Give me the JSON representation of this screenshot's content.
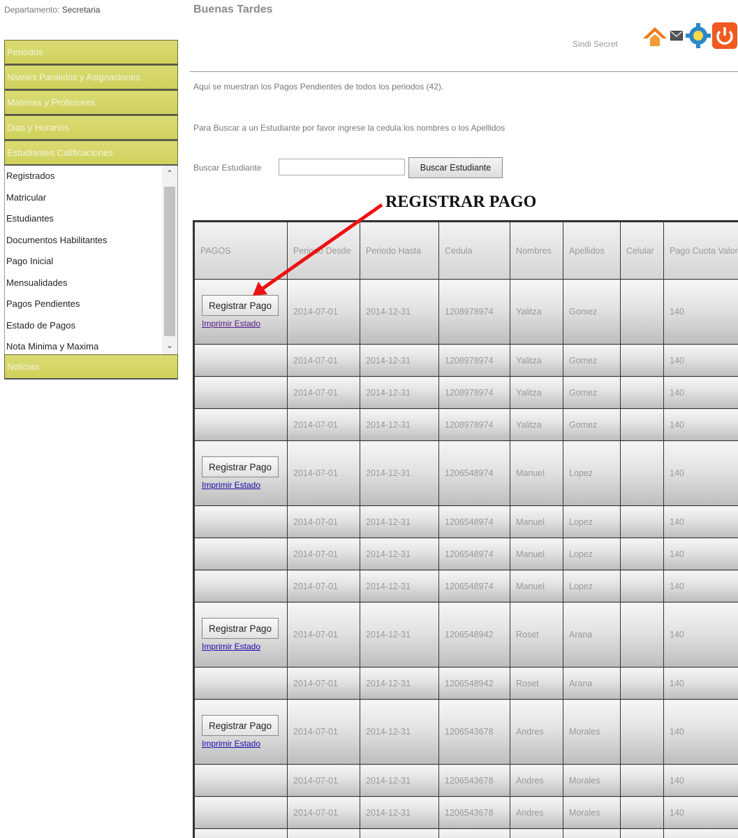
{
  "sidebar": {
    "department_label": "Departamento:",
    "department_value": "Secretaria",
    "menu": [
      "Periodos",
      "Niveles Paralelos y Asignaciones",
      "Materias y Profesores",
      "Dias y Horarios",
      "Estudiantes Calificaciones"
    ],
    "submenu": [
      "Registrados",
      "Matricular",
      "Estudiantes",
      "Documentos Habilitantes",
      "Pago Inicial",
      "Mensualidades",
      "Pagos Pendientes",
      "Estado de Pagos",
      "Nota Minima y Maxima"
    ],
    "last_menu": "Noticias",
    "accent_color": "#d5d766"
  },
  "header": {
    "greeting": "Buenas Tardes",
    "user": "Sindi Secret",
    "icons": [
      "home-icon",
      "mail-icon",
      "settings-icon",
      "power-icon"
    ]
  },
  "content": {
    "info_text": "Aqui se muestran los Pagos Pendientes de todos los periodos (42).",
    "search_help": "Para Buscar a un Estudiante por favor ingrese la cedula los nombres o los Apellidos",
    "search_label": "Buscar Estudiante",
    "search_value": "",
    "search_button": "Buscar Estudiante",
    "annotation": "REGISTRAR  PAGO"
  },
  "table": {
    "headers": [
      "PAGOS",
      "Periodo Desde",
      "Periodo Hasta",
      "Cedula",
      "Nombres",
      "Apellidos",
      "Celular",
      "Pago Cuota Valor"
    ],
    "register_label": "Registrar Pago",
    "print_label": "Imprimir Estado",
    "rows": [
      {
        "actions": true,
        "desde": "2014-07-01",
        "hasta": "2014-12-31",
        "cedula": "1208978974",
        "nombres": "Yalitza",
        "apellidos": "Gomez",
        "celular": "",
        "valor": "140"
      },
      {
        "actions": false,
        "desde": "2014-07-01",
        "hasta": "2014-12-31",
        "cedula": "1208978974",
        "nombres": "Yalitza",
        "apellidos": "Gomez",
        "celular": "",
        "valor": "140"
      },
      {
        "actions": false,
        "desde": "2014-07-01",
        "hasta": "2014-12-31",
        "cedula": "1208978974",
        "nombres": "Yalitza",
        "apellidos": "Gomez",
        "celular": "",
        "valor": "140"
      },
      {
        "actions": false,
        "desde": "2014-07-01",
        "hasta": "2014-12-31",
        "cedula": "1208978974",
        "nombres": "Yalitza",
        "apellidos": "Gomez",
        "celular": "",
        "valor": "140"
      },
      {
        "actions": true,
        "desde": "2014-07-01",
        "hasta": "2014-12-31",
        "cedula": "1206548974",
        "nombres": "Manuel",
        "apellidos": "Lopez",
        "celular": "",
        "valor": "140"
      },
      {
        "actions": false,
        "desde": "2014-07-01",
        "hasta": "2014-12-31",
        "cedula": "1206548974",
        "nombres": "Manuel",
        "apellidos": "Lopez",
        "celular": "",
        "valor": "140"
      },
      {
        "actions": false,
        "desde": "2014-07-01",
        "hasta": "2014-12-31",
        "cedula": "1206548974",
        "nombres": "Manuel",
        "apellidos": "Lopez",
        "celular": "",
        "valor": "140"
      },
      {
        "actions": false,
        "desde": "2014-07-01",
        "hasta": "2014-12-31",
        "cedula": "1206548974",
        "nombres": "Manuel",
        "apellidos": "Lopez",
        "celular": "",
        "valor": "140"
      },
      {
        "actions": true,
        "desde": "2014-07-01",
        "hasta": "2014-12-31",
        "cedula": "1206548942",
        "nombres": "Roset",
        "apellidos": "Arana",
        "celular": "",
        "valor": "140"
      },
      {
        "actions": false,
        "desde": "2014-07-01",
        "hasta": "2014-12-31",
        "cedula": "1206548942",
        "nombres": "Roset",
        "apellidos": "Arana",
        "celular": "",
        "valor": "140"
      },
      {
        "actions": true,
        "desde": "2014-07-01",
        "hasta": "2014-12-31",
        "cedula": "1206543678",
        "nombres": "Andres",
        "apellidos": "Morales",
        "celular": "",
        "valor": "140"
      },
      {
        "actions": false,
        "desde": "2014-07-01",
        "hasta": "2014-12-31",
        "cedula": "1206543678",
        "nombres": "Andres",
        "apellidos": "Morales",
        "celular": "",
        "valor": "140"
      },
      {
        "actions": false,
        "desde": "2014-07-01",
        "hasta": "2014-12-31",
        "cedula": "1206543678",
        "nombres": "Andres",
        "apellidos": "Morales",
        "celular": "",
        "valor": "140"
      },
      {
        "actions": false,
        "desde": "",
        "hasta": "",
        "cedula": "",
        "nombres": "",
        "apellidos": "",
        "celular": "",
        "valor": ""
      }
    ]
  }
}
